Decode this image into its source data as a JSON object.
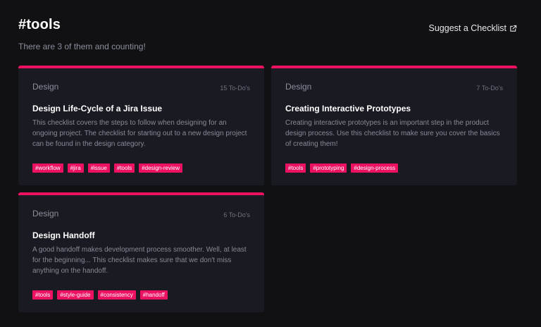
{
  "header": {
    "title": "#tools",
    "subtitle": "There are 3 of them and counting!",
    "suggest_label": "Suggest a Checklist"
  },
  "colors": {
    "accent": "#ed1261",
    "background": "#111113",
    "card": "#1a1b22"
  },
  "cards": [
    {
      "category": "Design",
      "count": "15 To-Do's",
      "title": "Design Life-Cycle of a Jira Issue",
      "description": "This checklist covers the steps to follow when designing for an ongoing project. The checklist for starting out to a new design project can be found in the design category.",
      "tags": [
        "#workflow",
        "#jira",
        "#issue",
        "#tools",
        "#design-review"
      ]
    },
    {
      "category": "Design",
      "count": "7 To-Do's",
      "title": "Creating Interactive Prototypes",
      "description": "Creating interactive prototypes is an important step in the product design process. Use this checklist to make sure you cover the basics of creating them!",
      "tags": [
        "#tools",
        "#prototyping",
        "#design-process"
      ]
    },
    {
      "category": "Design",
      "count": "6 To-Do's",
      "title": "Design Handoff",
      "description": "A good handoff makes development process smoother. Well, at least for the beginning... This checklist makes sure that we don't miss anything on the handoff.",
      "tags": [
        "#tools",
        "#style-guide",
        "#consistency",
        "#handoff"
      ]
    }
  ],
  "icons": {
    "external_link": "external-link-icon"
  }
}
